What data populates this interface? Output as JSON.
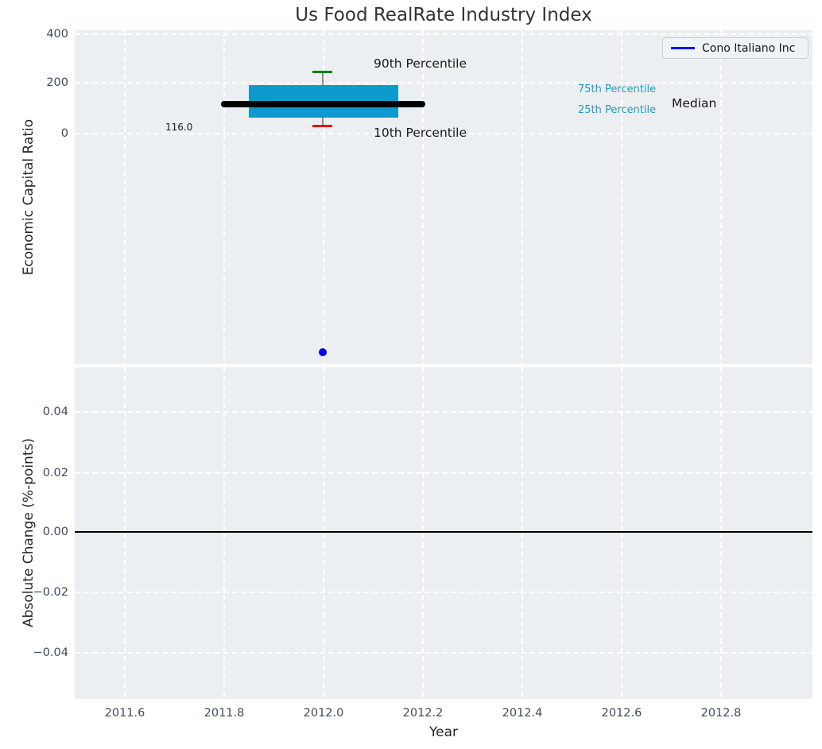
{
  "title": "Us Food RealRate Industry Index",
  "legend": {
    "label": "Cono Italiano Inc",
    "line_color": "#0000ee"
  },
  "colors": {
    "box": "#0d9bce",
    "percentile_text": "#189dce",
    "cap_90": "#008000",
    "cap_10": "#ee0000",
    "median_line": "#000000",
    "company_point": "#0000ee",
    "axes_background": "#eceff1",
    "tick_text": "#3e4a5a"
  },
  "top_chart": {
    "ylabel": "Economic Capital Ratio",
    "y_ticks": [
      "400",
      "200",
      "0"
    ],
    "annotations": {
      "p90": "90th Percentile",
      "p10": "10th Percentile",
      "p75": "75th Percentile",
      "p25": "25th Percentile",
      "median": "Median",
      "median_value": "116.0"
    }
  },
  "bottom_chart": {
    "ylabel": "Absolute Change (%-points)",
    "y_ticks": [
      "0.04",
      "0.02",
      "0.00",
      "−0.02",
      "−0.04"
    ]
  },
  "x_axis": {
    "label": "Year",
    "ticks": [
      "2011.6",
      "2011.8",
      "2012.0",
      "2012.2",
      "2012.4",
      "2012.6",
      "2012.8"
    ]
  },
  "chart_data": [
    {
      "type": "boxplot",
      "title": "Us Food RealRate Industry Index",
      "xlabel": "Year",
      "ylabel": "Economic Capital Ratio",
      "x": 2012.0,
      "box": {
        "median": 116.0,
        "p25": 64,
        "p75": 191,
        "p10": 29,
        "p90": 244,
        "box_x_range": [
          2011.85,
          2012.15
        ],
        "median_x_range": [
          2011.8,
          2012.2
        ]
      },
      "points": [
        {
          "name": "Cono Italiano Inc",
          "x": 2012.0,
          "y": -880
        }
      ],
      "y_ticks": [
        0,
        200,
        400
      ],
      "ylim": [
        -935,
        415
      ],
      "xlim": [
        2011.5,
        2013.0
      ],
      "grid": true,
      "legend_position": "upper right",
      "legend_entries": [
        "Cono Italiano Inc"
      ]
    },
    {
      "type": "line",
      "xlabel": "Year",
      "ylabel": "Absolute Change (%-points)",
      "x_ticks": [
        2011.6,
        2011.8,
        2012.0,
        2012.2,
        2012.4,
        2012.6,
        2012.8
      ],
      "y_ticks": [
        0.04,
        0.02,
        0.0,
        -0.02,
        -0.04
      ],
      "ylim": [
        -0.055,
        0.055
      ],
      "xlim": [
        2011.5,
        2013.0
      ],
      "series": [],
      "zero_line": 0.0,
      "grid": true
    }
  ]
}
